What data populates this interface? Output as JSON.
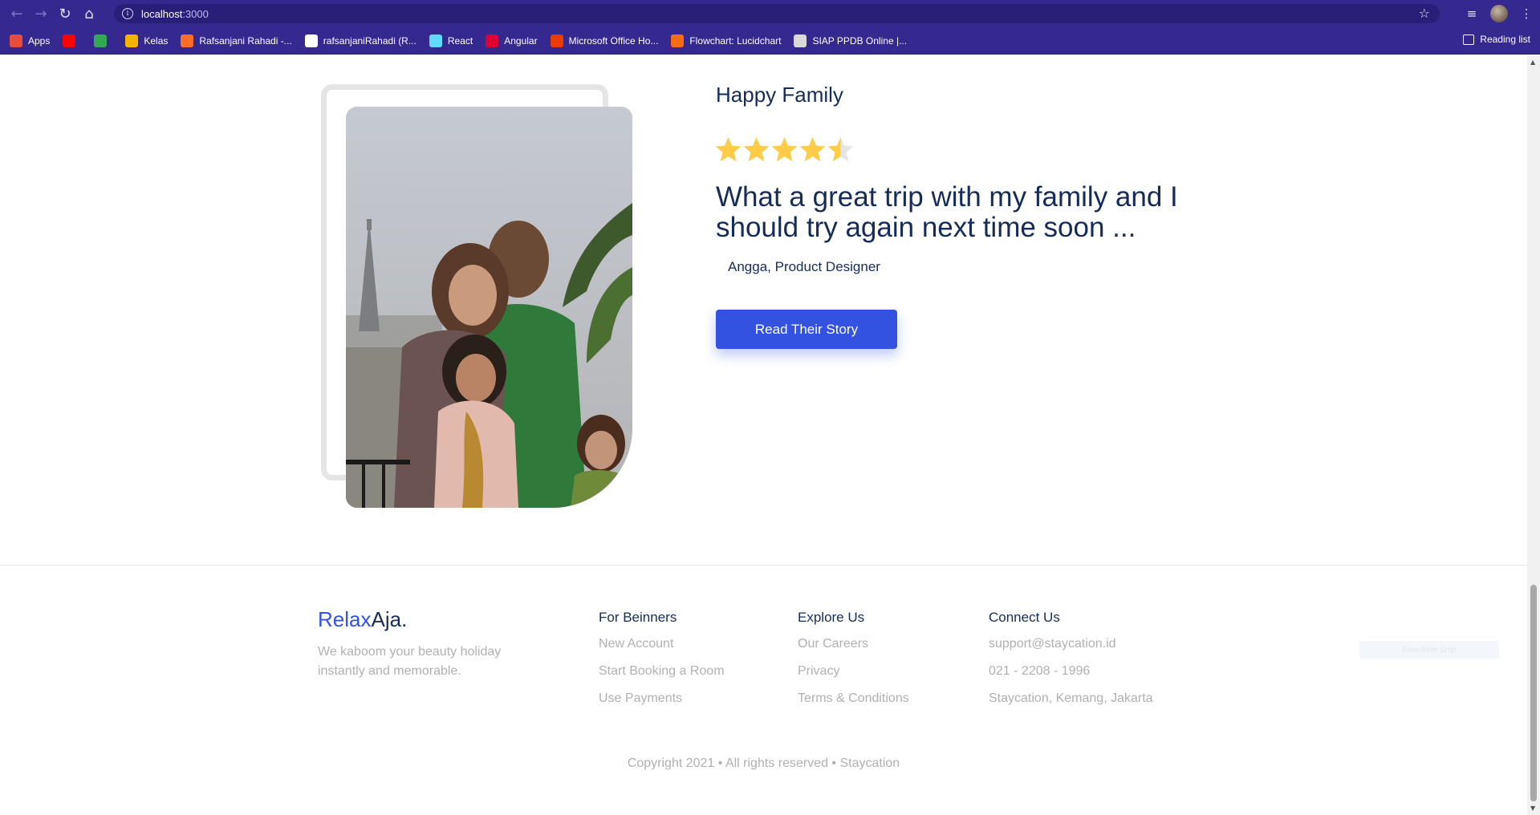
{
  "browser": {
    "url_host": "localhost",
    "url_port": ":3000",
    "bookmarks": [
      {
        "label": "Apps",
        "icon": "apps-grid-icon",
        "color": "#e84c3d"
      },
      {
        "label": "",
        "icon": "youtube-icon",
        "color": "#ff0000"
      },
      {
        "label": "",
        "icon": "google-drive-icon",
        "color": "#34a853"
      },
      {
        "label": "Kelas",
        "icon": "classroom-icon",
        "color": "#f4b400"
      },
      {
        "label": "Rafsanjani Rahadi -...",
        "icon": "gitlab-icon",
        "color": "#fc6d26"
      },
      {
        "label": "rafsanjaniRahadi (R...",
        "icon": "github-icon",
        "color": "#ffffff"
      },
      {
        "label": "React",
        "icon": "react-icon",
        "color": "#61dafb"
      },
      {
        "label": "Angular",
        "icon": "angular-icon",
        "color": "#dd0031"
      },
      {
        "label": "Microsoft Office Ho...",
        "icon": "office-icon",
        "color": "#eb3c00"
      },
      {
        "label": "Flowchart: Lucidchart",
        "icon": "lucidchart-icon",
        "color": "#f96b13"
      },
      {
        "label": "SIAP PPDB Online |...",
        "icon": "ppdb-icon",
        "color": "#d9d9d9"
      }
    ],
    "reading_list": "Reading list"
  },
  "testimonial": {
    "title": "Happy Family",
    "rating": 4.5,
    "rating_max": 5,
    "quote": "What a great trip with my family and I should try again next time soon ...",
    "author": "Angga, Product Designer",
    "button_label": "Read Their Story",
    "star_color": "#ffcc47",
    "star_empty_color": "#e5e5e5"
  },
  "footer": {
    "brand_part1": "Relax",
    "brand_part2": "Aja.",
    "tagline": "We kaboom your beauty holiday instantly and memorable.",
    "columns": [
      {
        "heading": "For Beinners",
        "links": [
          "New Account",
          "Start Booking a Room",
          "Use Payments"
        ]
      },
      {
        "heading": "Explore Us",
        "links": [
          "Our Careers",
          "Privacy",
          "Terms & Conditions"
        ]
      },
      {
        "heading": "Connect Us",
        "links": [
          "support@staycation.id",
          "021 - 2208 - 1996",
          "Staycation, Kemang, Jakarta"
        ]
      }
    ],
    "faint_label": "Free-form Snip",
    "copyright": "Copyright 2021 • All rights reserved • Staycation"
  },
  "colors": {
    "accent": "#3252df",
    "heading": "#152c5b",
    "muted": "#b0b0b0",
    "chrome": "#35288f"
  }
}
